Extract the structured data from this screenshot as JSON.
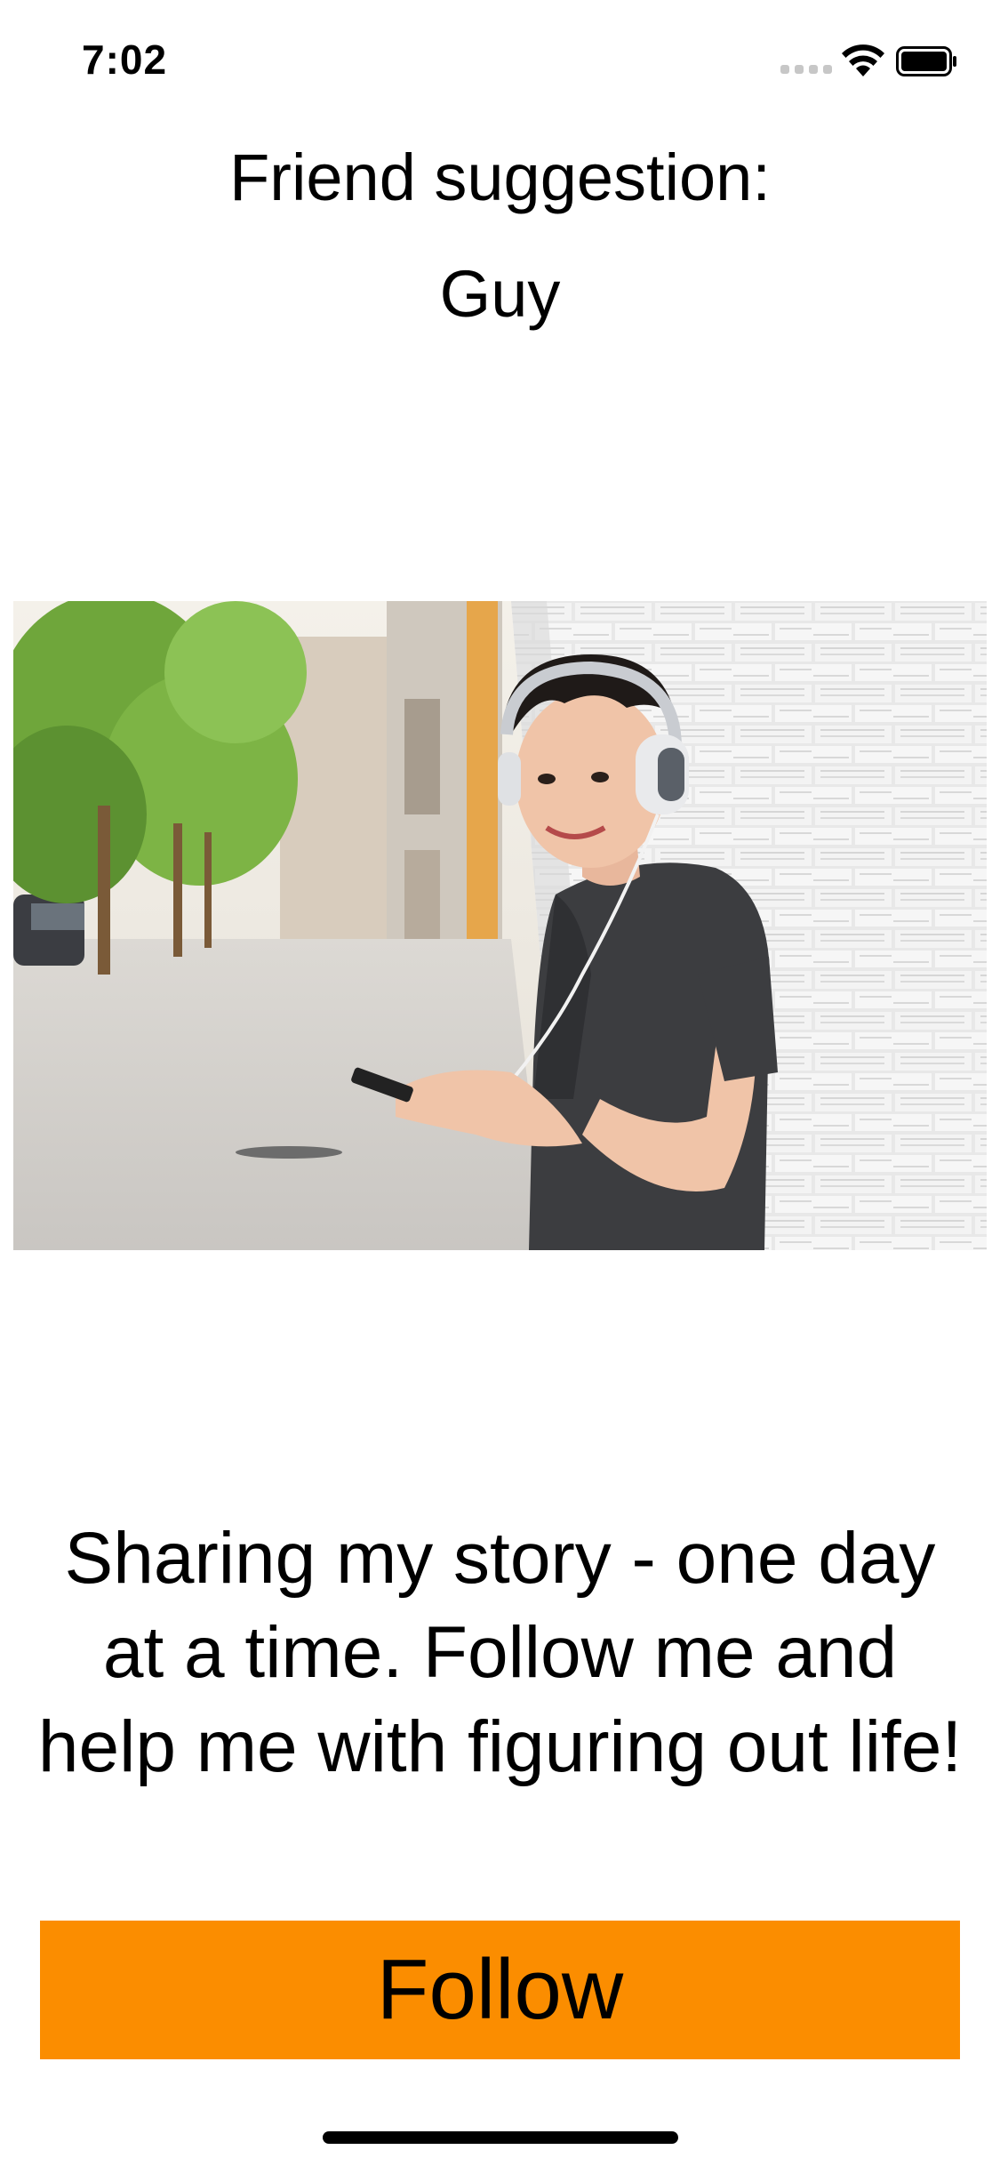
{
  "status_bar": {
    "time": "7:02",
    "signal_icon": "cellular-signal-icon",
    "wifi_icon": "wifi-icon",
    "battery_icon": "battery-icon"
  },
  "header": {
    "title": "Friend suggestion:",
    "name": "Guy"
  },
  "profile": {
    "photo": "profile-photo"
  },
  "bio": {
    "text": "Sharing my story - one day at a time. Follow me and help me with figuring out life!"
  },
  "actions": {
    "follow_label": "Follow",
    "follow_color": "#fb8d00"
  }
}
